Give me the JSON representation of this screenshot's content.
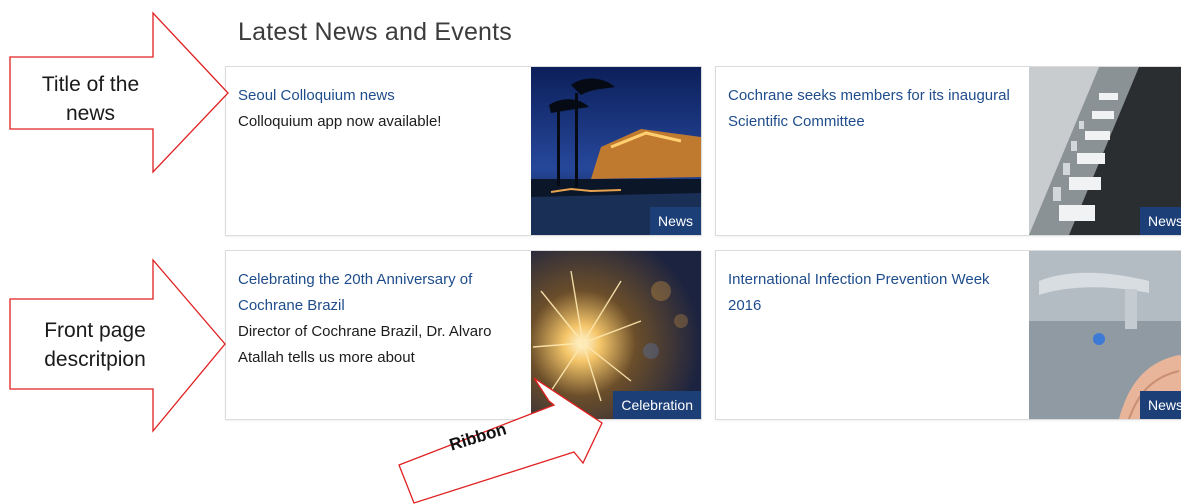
{
  "section": {
    "title": "Latest News and Events"
  },
  "cards": [
    {
      "title": "Seoul Colloquium news",
      "description": "Colloquium app now available!",
      "ribbon": "News",
      "image": "night-pagoda-photo"
    },
    {
      "title": "Cochrane seeks members for its inaugural Scientific Committee",
      "description": "",
      "ribbon": "News",
      "image": "conference-table-photo"
    },
    {
      "title": "Celebrating the 20th Anniversary of Cochrane Brazil",
      "description": "Director of Cochrane Brazil, Dr. Alvaro Atallah tells us more about",
      "ribbon": "Celebration",
      "image": "sparkler-photo"
    },
    {
      "title": "International Infection Prevention Week 2016",
      "description": "",
      "ribbon": "News",
      "image": "handwashing-photo"
    }
  ],
  "annotations": {
    "title_of_news": "Title of the news",
    "front_page_description": "Front page descritpion",
    "ribbon": "Ribbon"
  },
  "colors": {
    "title_link": "#1f4d8c",
    "ribbon_bg": "#1d3f78",
    "annotation_stroke": "#e02020"
  }
}
